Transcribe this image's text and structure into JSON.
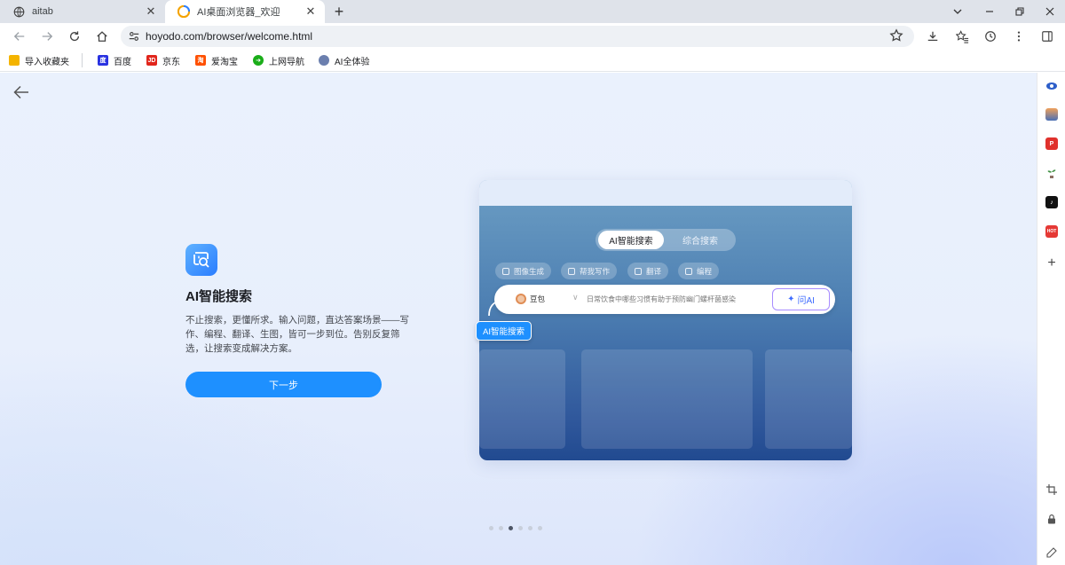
{
  "tabs": [
    {
      "title": "aitab"
    },
    {
      "title": "AI桌面浏览器_欢迎"
    }
  ],
  "address_bar": {
    "url": "hoyodo.com/browser/welcome.html"
  },
  "bookmarks": [
    {
      "label": "导入收藏夹",
      "color": "#f4b400"
    },
    {
      "label": "百度",
      "color": "#2932e1"
    },
    {
      "label": "京东",
      "color": "#e1251b"
    },
    {
      "label": "爱淘宝",
      "color": "#ff5000"
    },
    {
      "label": "上网导航",
      "color": "#1aad19"
    },
    {
      "label": "AI全体验",
      "color": "#6b7fae"
    }
  ],
  "feature": {
    "title": "AI智能搜索",
    "description": "不止搜索，更懂所求。输入问题，直达答案场景——写作、编程、翻译、生图，皆可一步到位。告别反复筛选，让搜索变成解决方案。",
    "next_button": "下一步",
    "accent": "#1e90ff"
  },
  "preview": {
    "tabs": {
      "active": "AI智能搜索",
      "other": "综合搜索"
    },
    "chips": [
      "图像生成",
      "帮我写作",
      "翻译",
      "编程"
    ],
    "model": "豆包",
    "query": "日常饮食中哪些习惯有助于预防幽门螺杆菌感染",
    "ask_button": "问AI",
    "callout": "AI智能搜索"
  },
  "pagination": {
    "total": 6,
    "current": 3
  }
}
